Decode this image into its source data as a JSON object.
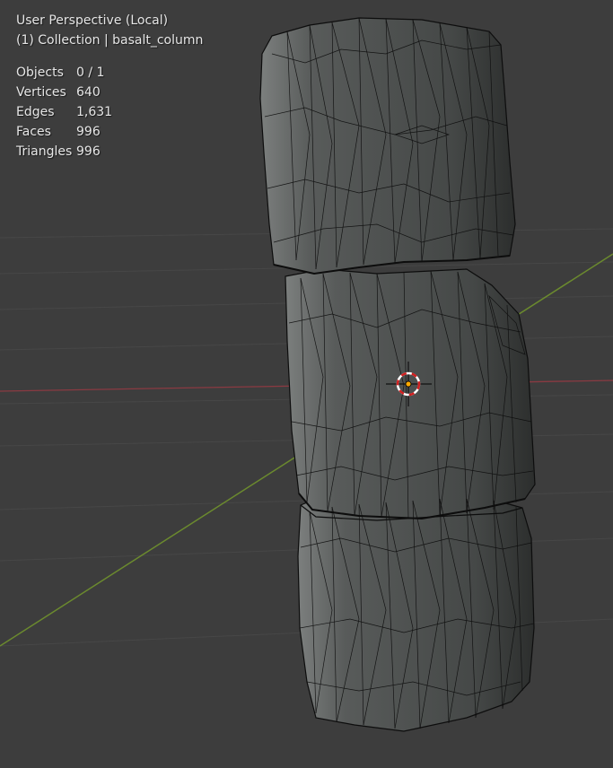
{
  "viewport": {
    "title": "User Perspective (Local)",
    "collection": "(1) Collection | basalt_column"
  },
  "stats": [
    {
      "label": "Objects",
      "value": "0 / 1"
    },
    {
      "label": "Vertices",
      "value": "640"
    },
    {
      "label": "Edges",
      "value": "1,631"
    },
    {
      "label": "Faces",
      "value": "996"
    },
    {
      "label": "Triangles",
      "value": "996"
    }
  ],
  "colors": {
    "background": "#3d3d3d",
    "grid": "#474747",
    "x_axis": "#8a3a42",
    "y_axis": "#6b8a2e",
    "mesh": "#5a5d5c",
    "wire": "#0d0d0d",
    "cursor_red": "#d02020",
    "cursor_white": "#ffffff",
    "origin": "#ffaa00"
  },
  "icons": {
    "3d_cursor": "3d-cursor-icon"
  }
}
